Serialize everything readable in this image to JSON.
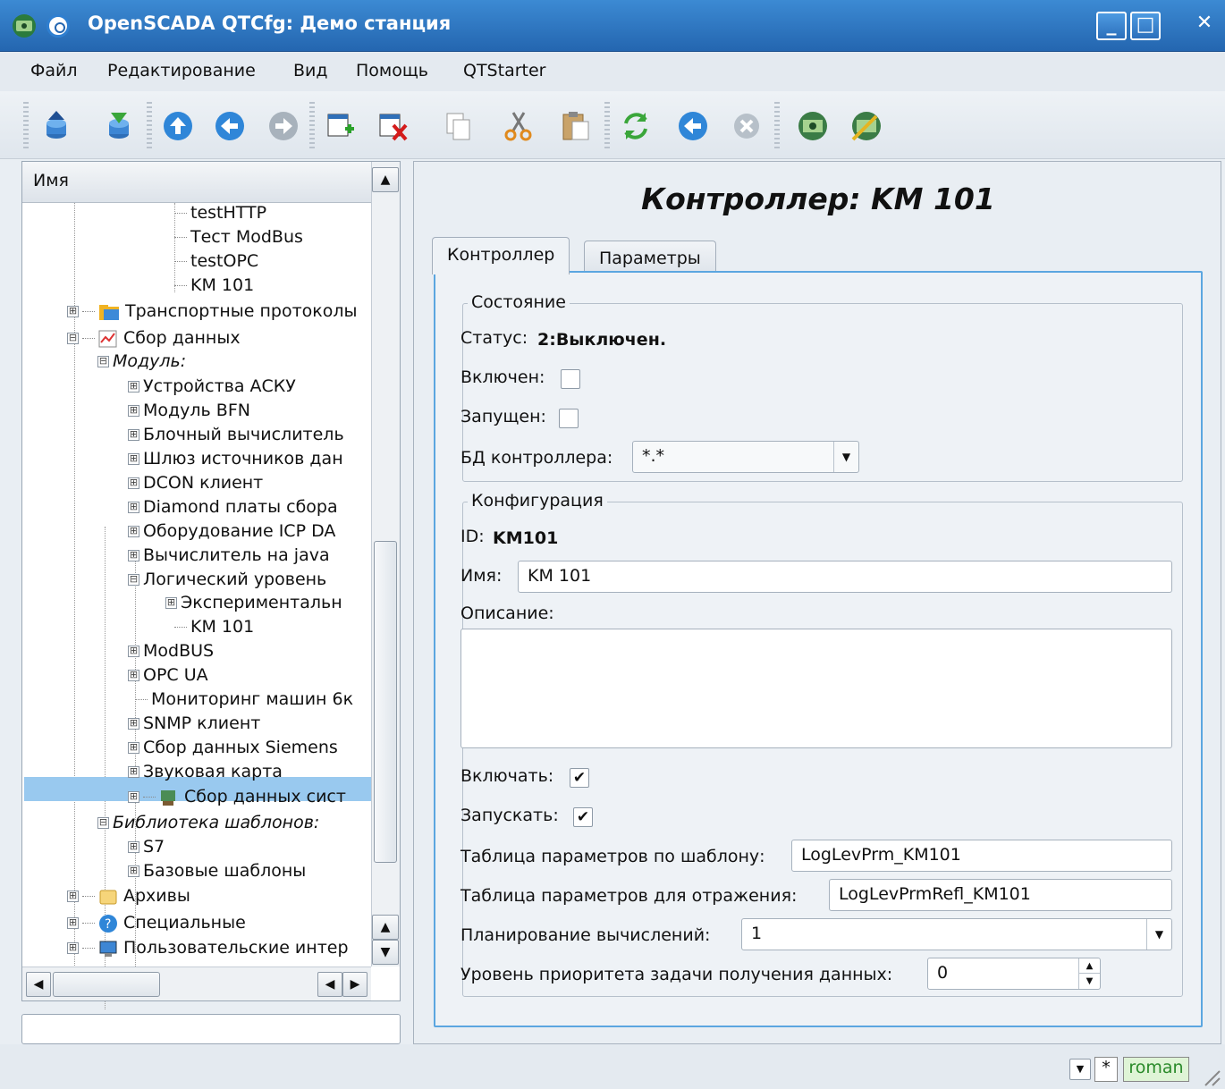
{
  "window": {
    "title": "OpenSCADA QTCfg: Демо станция",
    "minimize": "_",
    "maximize": "□",
    "close": "✕"
  },
  "menu": [
    "Файл",
    "Редактирование",
    "Вид",
    "Помощь",
    "QTStarter"
  ],
  "toolbar": {
    "icons": [
      "db-load-icon",
      "db-save-icon",
      "up-icon",
      "back-icon",
      "forward-icon",
      "add-item-icon",
      "delete-item-icon",
      "copy-icon",
      "cut-icon",
      "paste-icon",
      "refresh-icon",
      "start-icon",
      "stop-icon",
      "station-icon",
      "station-config-icon"
    ]
  },
  "tree": {
    "header": "Имя",
    "items": [
      {
        "label": "testHTTP"
      },
      {
        "label": "Тест ModBus"
      },
      {
        "label": "testOPC"
      },
      {
        "label": "KM 101"
      },
      {
        "label": "Транспортные протоколы"
      },
      {
        "label": "Сбор данных"
      },
      {
        "label": "Модуль:"
      },
      {
        "label": "Устройства АСКУ"
      },
      {
        "label": "Модуль BFN"
      },
      {
        "label": "Блочный вычислитель"
      },
      {
        "label": "Шлюз источников дан"
      },
      {
        "label": "DCON клиент"
      },
      {
        "label": "Diamond платы сбора"
      },
      {
        "label": "Оборудование ICP DA"
      },
      {
        "label": "Вычислитель на java"
      },
      {
        "label": "Логический уровень"
      },
      {
        "label": "Экспериментальн"
      },
      {
        "label": "KM 101"
      },
      {
        "label": "ModBUS"
      },
      {
        "label": "OPC UA"
      },
      {
        "label": "Мониторинг машин 6к"
      },
      {
        "label": "SNMP клиент"
      },
      {
        "label": "Сбор данных Siemens"
      },
      {
        "label": "Звуковая карта"
      },
      {
        "label": "Сбор данных сист"
      },
      {
        "label": "Библиотека шаблонов:"
      },
      {
        "label": "S7"
      },
      {
        "label": "Базовые шаблоны"
      },
      {
        "label": "Архивы"
      },
      {
        "label": "Специальные"
      },
      {
        "label": "Пользовательские интер"
      }
    ],
    "plus": "⊞",
    "minus": "⊟"
  },
  "page": {
    "title": "Контроллер: KM 101",
    "tabs": [
      "Контроллер",
      "Параметры"
    ],
    "state": {
      "legend": "Состояние",
      "status_label": "Статус:",
      "status_value": "2:Выключен.",
      "enabled_label": "Включен:",
      "running_label": "Запущен:",
      "db_label": "БД контроллера:",
      "db_value": "*.*"
    },
    "config": {
      "legend": "Конфигурация",
      "id_label": "ID:",
      "id_value": "KM101",
      "name_label": "Имя:",
      "name_value": "KM 101",
      "descr_label": "Описание:",
      "descr_value": "",
      "to_enable_label": "Включать:",
      "to_enable_checked": true,
      "to_start_label": "Запускать:",
      "to_start_checked": true,
      "tmpl_table_label": "Таблица параметров по шаблону:",
      "tmpl_table_value": "LogLevPrm_KM101",
      "refl_table_label": "Таблица параметров для отражения:",
      "refl_table_value": "LogLevPrmRefl_KM101",
      "schedule_label": "Планирование вычислений:",
      "schedule_value": "1",
      "prior_label": "Уровень приоритета задачи получения данных:",
      "prior_value": "0"
    }
  },
  "statusbar": {
    "user": "roman",
    "modified": "*"
  }
}
